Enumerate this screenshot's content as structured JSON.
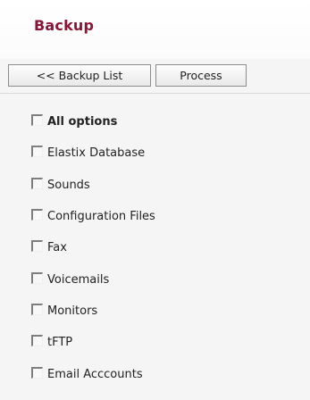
{
  "header": {
    "title": "Backup"
  },
  "toolbar": {
    "back_label": "<< Backup List",
    "process_label": "Process"
  },
  "options": [
    {
      "label": "All options",
      "checked": false
    },
    {
      "label": "Elastix Database",
      "checked": false
    },
    {
      "label": "Sounds",
      "checked": false
    },
    {
      "label": "Configuration Files",
      "checked": false
    },
    {
      "label": "Fax",
      "checked": false
    },
    {
      "label": "Voicemails",
      "checked": false
    },
    {
      "label": "Monitors",
      "checked": false
    },
    {
      "label": "tFTP",
      "checked": false
    },
    {
      "label": "Email Acccounts",
      "checked": false
    }
  ]
}
